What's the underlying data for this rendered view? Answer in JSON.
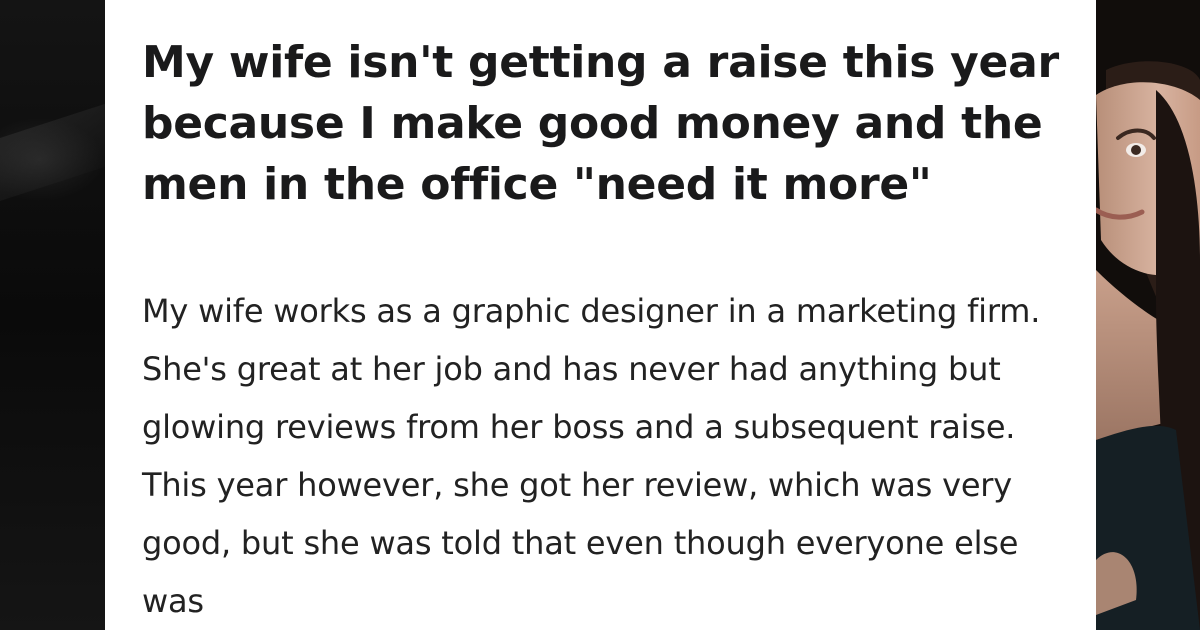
{
  "post": {
    "title": "My wife isn't getting a raise this year because I make good money and the men in the office \"need it more\"",
    "body": "My wife works as a graphic designer in a marketing firm. She's great at her job and has never had anything but glowing reviews from her boss and a subsequent raise. This year however, she got her review, which was very good, but she was told that even though everyone else was"
  },
  "colors": {
    "card_background": "#ffffff",
    "title_text": "#1a1a1b",
    "body_text": "#222222",
    "backdrop": "#0c0c0c"
  },
  "images": {
    "right_photo": "woman-portrait-photo"
  }
}
